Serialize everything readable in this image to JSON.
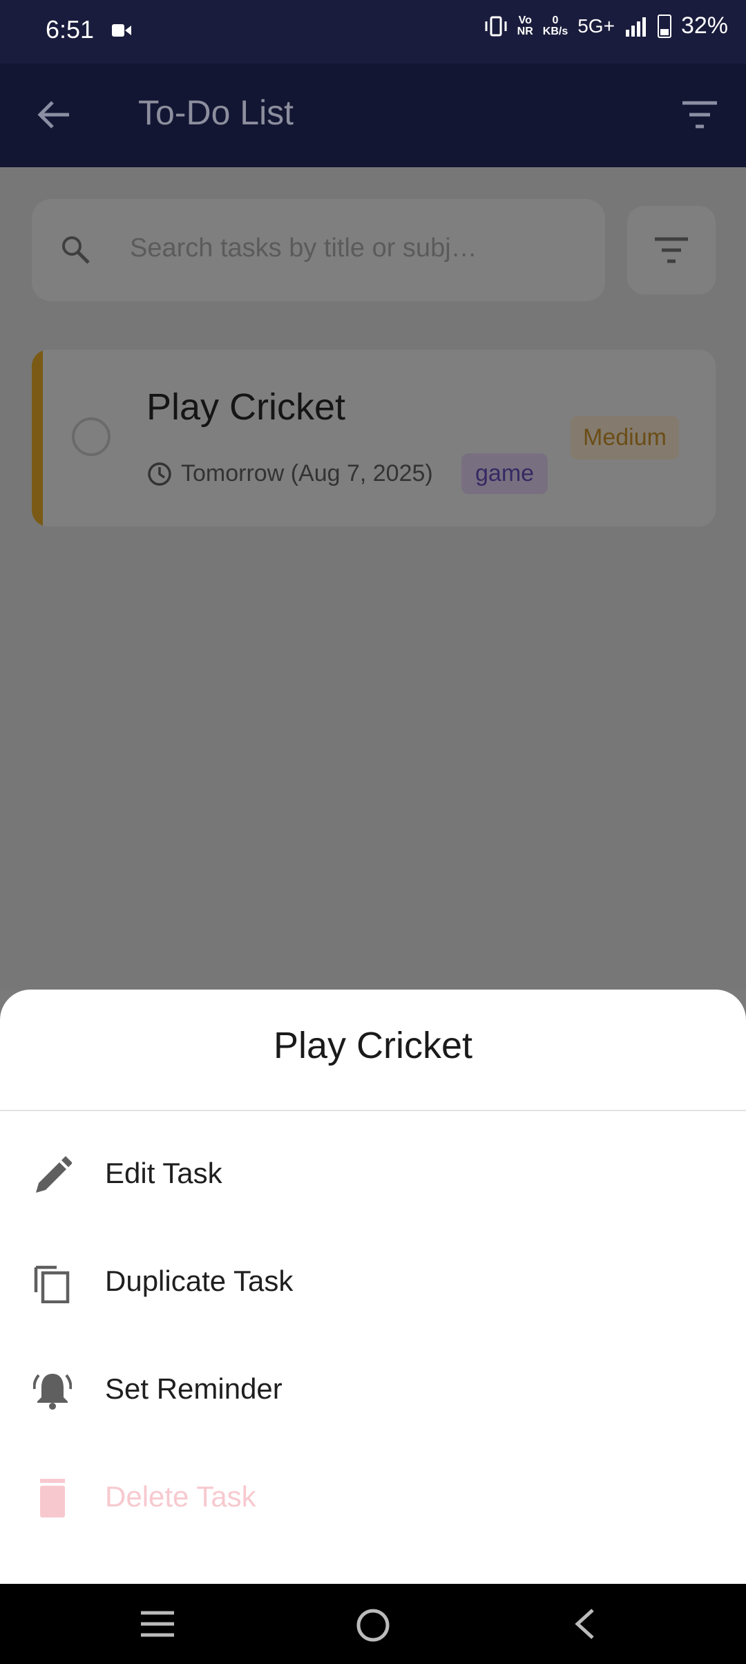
{
  "status_bar": {
    "time": "6:51",
    "volte": "Vo\nNR",
    "speed": "0\nKB/s",
    "network": "5G+",
    "battery": "32%"
  },
  "app_bar": {
    "title": "To-Do List"
  },
  "search": {
    "placeholder": "Search tasks by title or subj…"
  },
  "tasks": [
    {
      "title": "Play Cricket",
      "due": "Tomorrow (Aug 7, 2025)",
      "tag": "game",
      "priority": "Medium"
    }
  ],
  "sheet": {
    "title": "Play Cricket",
    "items": [
      {
        "label": "Edit Task",
        "icon": "pencil-icon"
      },
      {
        "label": "Duplicate Task",
        "icon": "copy-icon"
      },
      {
        "label": "Set Reminder",
        "icon": "bell-icon"
      },
      {
        "label": "Delete Task",
        "icon": "trash-icon"
      }
    ]
  },
  "colors": {
    "app_bar": "#131633",
    "priority_accent": "#f0a20a",
    "danger": "#f7c9cf",
    "tag_text": "#6a4bc4"
  }
}
